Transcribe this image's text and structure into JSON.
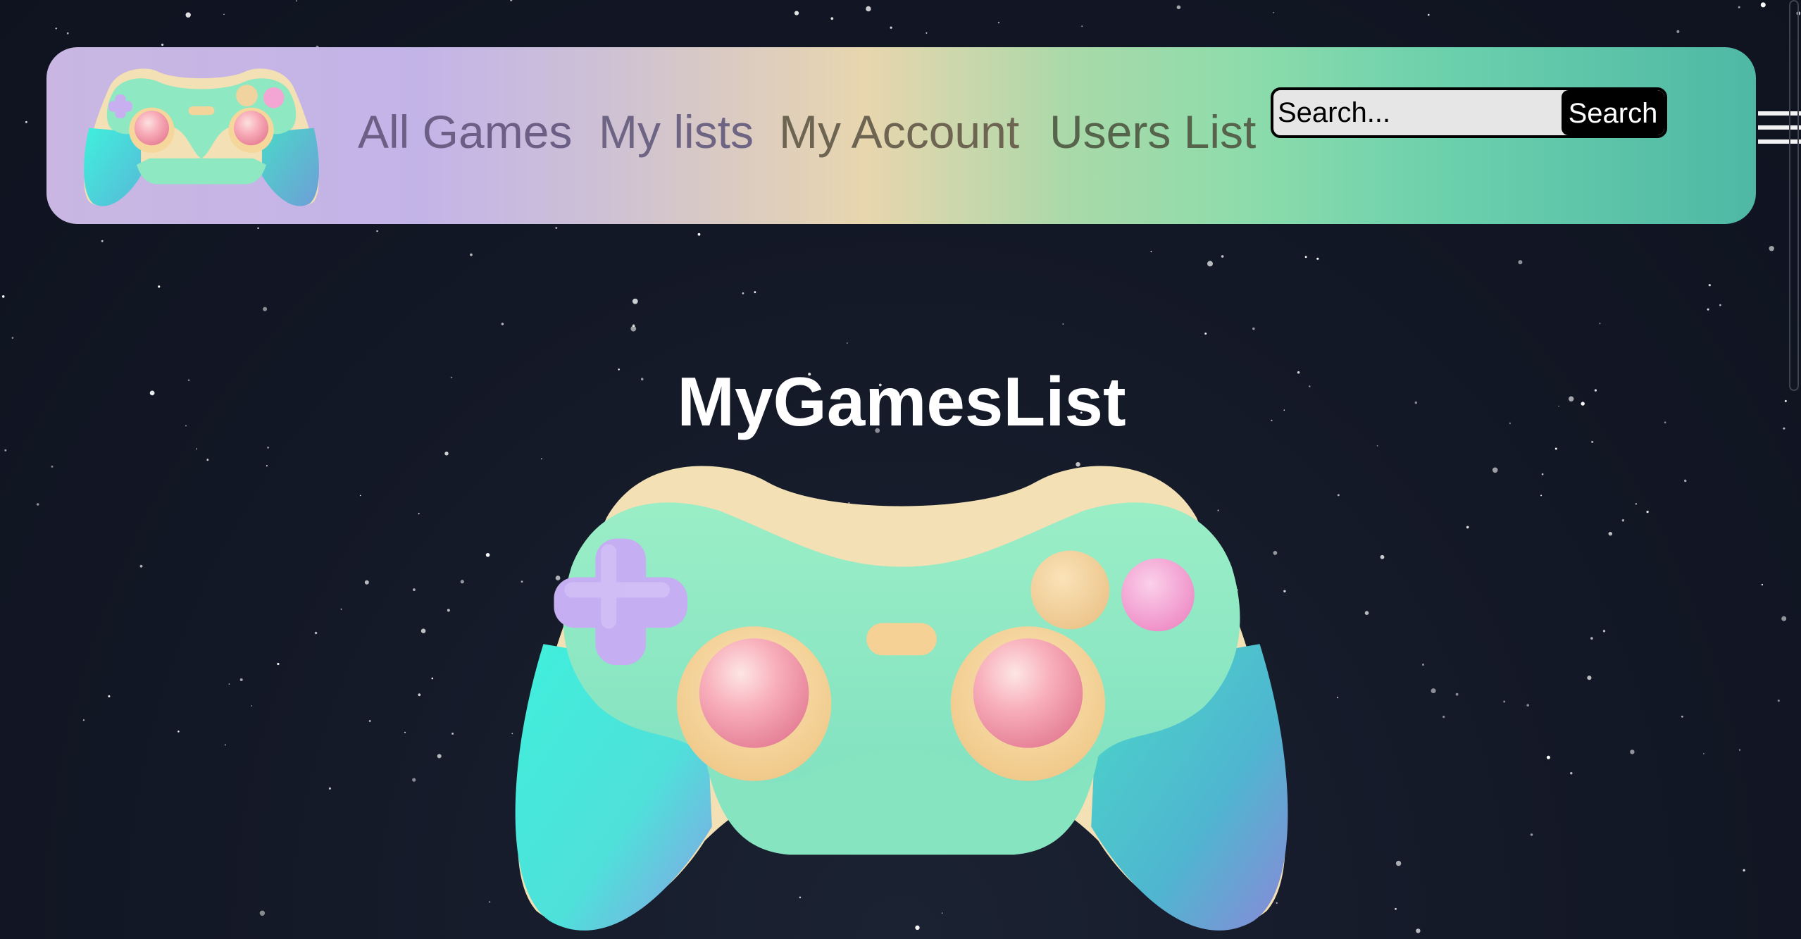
{
  "nav": {
    "links": [
      {
        "label": "All Games",
        "color": "#6b5f86"
      },
      {
        "label": "My lists",
        "color": "#6e6483"
      },
      {
        "label": "My Account",
        "color": "#6d6552"
      },
      {
        "label": "Users List",
        "color": "#56644c"
      }
    ],
    "logo_icon": "gamepad-icon",
    "menu_icon": "hamburger-menu-icon"
  },
  "search": {
    "placeholder": "Search...",
    "value": "",
    "button_label": "Search"
  },
  "main": {
    "title": "MyGamesList",
    "hero_icon": "gamepad-icon"
  },
  "colors": {
    "background": "#121724",
    "controller_body": "#8ee8c2",
    "controller_rim": "#f3e0b4",
    "controller_grip": "#48e6d6",
    "dpad": "#c8b0f0",
    "stick": "#f49db0",
    "button_peach": "#f1d3a0",
    "button_pink": "#f3a6d3"
  }
}
